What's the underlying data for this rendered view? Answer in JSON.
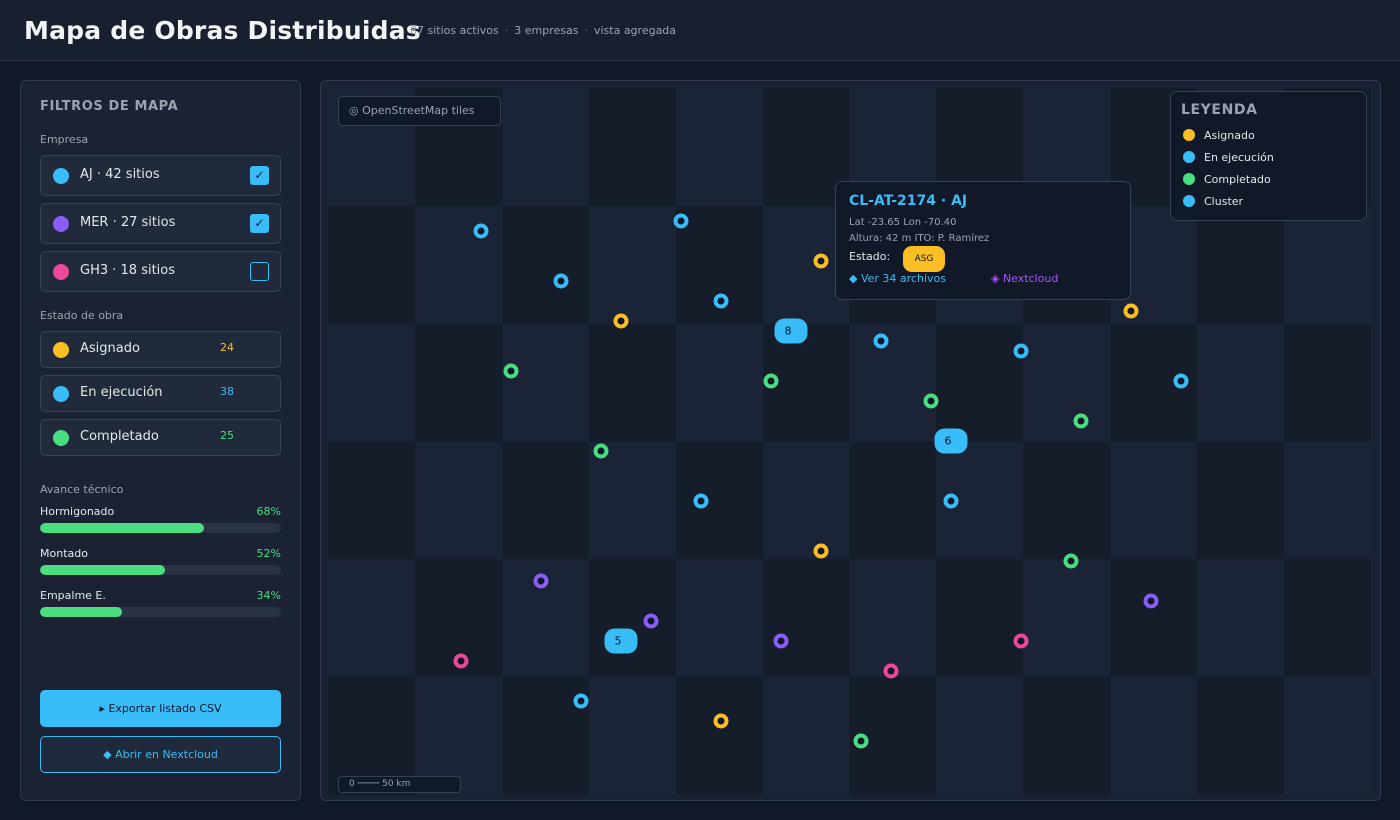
{
  "header": {
    "title": "Mapa de Obras Distribuidas",
    "meta": [
      "87 sitios activos",
      "3 empresas",
      "vista agregada"
    ]
  },
  "sidebar": {
    "title": "FILTROS DE MAPA",
    "company_label": "Empresa",
    "companies": [
      {
        "label": "AJ  ·  42 sitios",
        "color": "#38bdf8",
        "checked": true
      },
      {
        "label": "MER  ·  27 sitios",
        "color": "#8b5cf6",
        "checked": true
      },
      {
        "label": "GH3  ·  18 sitios",
        "color": "#ec4899",
        "checked": false
      }
    ],
    "state_label": "Estado de obra",
    "states": [
      {
        "label": "Asignado",
        "count": "24",
        "color": "#fbbf24"
      },
      {
        "label": "En ejecución",
        "count": "38",
        "color": "#38bdf8"
      },
      {
        "label": "Completado",
        "count": "25",
        "color": "#4ade80"
      }
    ],
    "progress_label": "Avance técnico",
    "progress": [
      {
        "label": "Hormigonado",
        "pct": "68%",
        "value": 68
      },
      {
        "label": "Montado",
        "pct": "52%",
        "value": 52
      },
      {
        "label": "Empalme E.",
        "pct": "34%",
        "value": 34
      }
    ],
    "export_button": "▸ Exportar listado CSV",
    "nextcloud_button": "◆ Abrir en Nextcloud"
  },
  "map": {
    "tiles_badge": "◎ OpenStreetMap tiles",
    "scale": "0 ──── 50 km",
    "popup": {
      "title": "CL-AT-2174  ·  AJ",
      "coords": "Lat -23.65  Lon -70.40",
      "details": "Altura: 42 m   ITO: P. Ramírez",
      "state_label": "Estado:",
      "state_badge": "ASG",
      "files_link": "◆ Ver 34 archivos",
      "nextcloud_link": "◈ Nextcloud"
    },
    "legend": {
      "title": "LEYENDA",
      "items": [
        {
          "label": "Asignado",
          "color": "#fbbf24"
        },
        {
          "label": "En ejecución",
          "color": "#38bdf8"
        },
        {
          "label": "Completado",
          "color": "#4ade80"
        },
        {
          "label": "Cluster",
          "color": "#38bdf8"
        }
      ]
    },
    "clusters": [
      {
        "count": "8"
      },
      {
        "count": "6"
      },
      {
        "count": "5"
      }
    ],
    "colors": {
      "asignado": "#fbbf24",
      "ejecucion": "#38bdf8",
      "completado": "#4ade80",
      "mer": "#8b5cf6",
      "gh3": "#ec4899"
    }
  }
}
